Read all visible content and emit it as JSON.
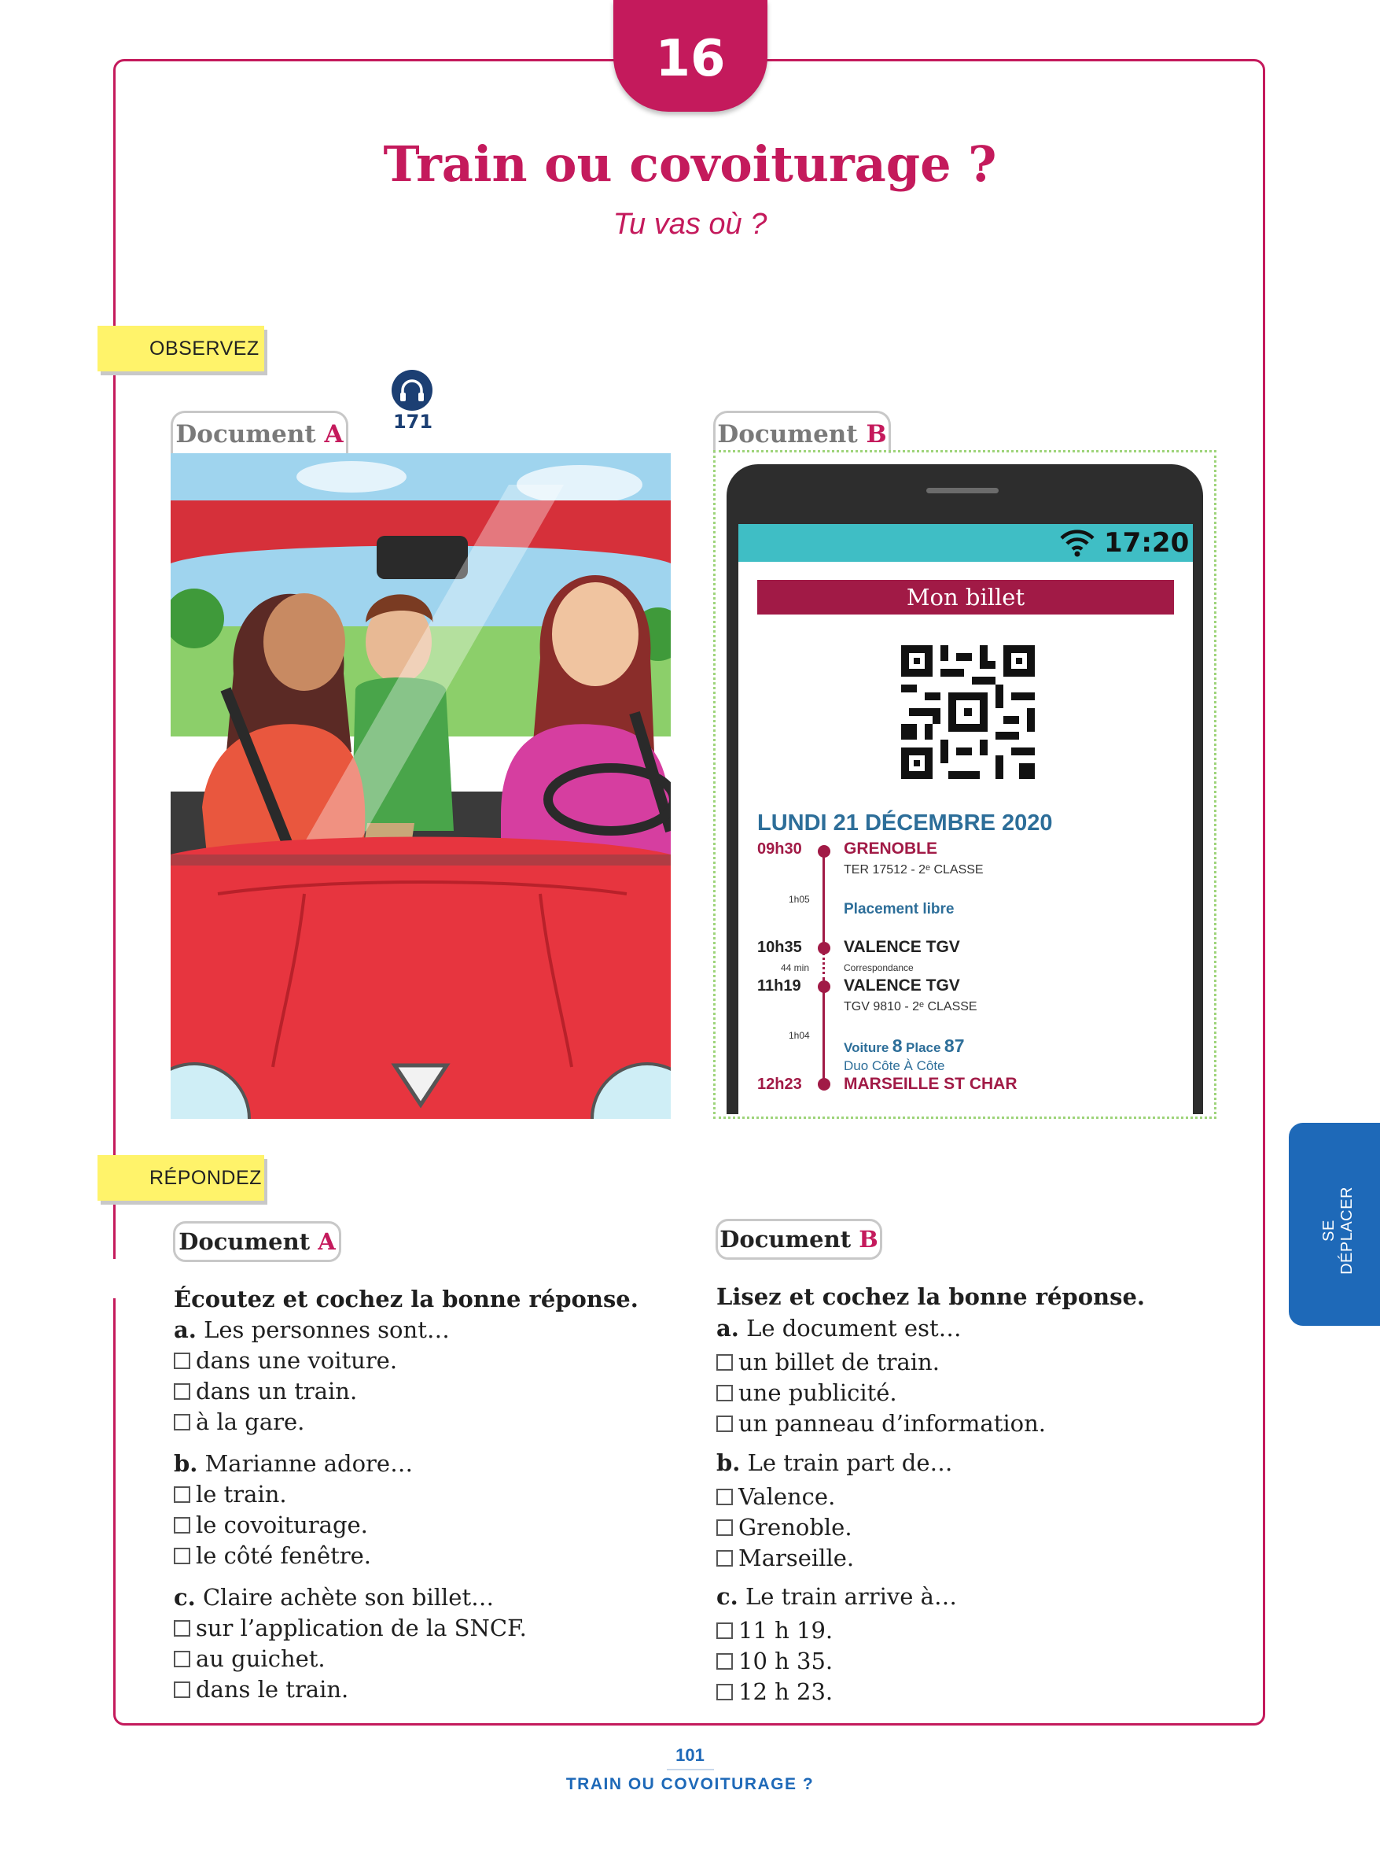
{
  "lesson": {
    "number": "16",
    "title": "Train ou covoiturage ?",
    "subtitle": "Tu vas où ?"
  },
  "sections": {
    "observe": "OBSERVEZ",
    "answer": "RÉPONDEZ"
  },
  "documents": {
    "a_label": "Document",
    "a_letter": "A",
    "b_label": "Document",
    "b_letter": "B"
  },
  "audio": {
    "icon": "headphones-icon",
    "track": "171"
  },
  "ticket": {
    "time": "17:20",
    "banner": "Mon billet",
    "date": "LUNDI 21 DÉCEMBRE 2020",
    "stops": [
      {
        "time": "09h30",
        "station": "GRENOBLE",
        "detail": "TER 17512 - 2ᵉ CLASSE"
      },
      {
        "time": "10h35",
        "station": "VALENCE TGV"
      },
      {
        "time": "11h19",
        "station": "VALENCE TGV",
        "detail": "TGV 9810 - 2ᵉ CLASSE"
      },
      {
        "time": "12h23",
        "station": "MARSEILLE ST CHAR"
      }
    ],
    "leg1_duration": "1h05",
    "leg1_seat": "Placement libre",
    "connection_duration": "44 min",
    "connection_label": "Correspondance",
    "leg2_duration": "1h04",
    "voiture_label": "Voiture",
    "voiture_value": "8",
    "place_label": "Place",
    "place_value": "87",
    "duo_label": "Duo Côte À Côte"
  },
  "doc_a_questions": {
    "instruction": "Écoutez et cochez la bonne réponse.",
    "questions": [
      {
        "letter": "a.",
        "stem": "Les personnes sont…",
        "options": [
          "dans une voiture.",
          "dans un train.",
          "à la gare."
        ]
      },
      {
        "letter": "b.",
        "stem": "Marianne adore…",
        "options": [
          "le train.",
          "le covoiturage.",
          "le côté fenêtre."
        ]
      },
      {
        "letter": "c.",
        "stem": "Claire achète son billet…",
        "options": [
          "sur l’application de la SNCF.",
          "au guichet.",
          "dans le train."
        ]
      }
    ]
  },
  "doc_b_questions": {
    "instruction": "Lisez et cochez la bonne réponse.",
    "questions": [
      {
        "letter": "a.",
        "stem": "Le document est…",
        "options": [
          "un billet de train.",
          "une publicité.",
          "un panneau d’information."
        ]
      },
      {
        "letter": "b.",
        "stem": "Le train part de…",
        "options": [
          "Valence.",
          "Grenoble.",
          "Marseille."
        ]
      },
      {
        "letter": "c.",
        "stem": "Le train arrive à…",
        "options": [
          "11 h 19.",
          "10 h 35.",
          "12 h 23."
        ]
      }
    ]
  },
  "side_tab": "SE DÉPLACER",
  "footer": {
    "page_number": "101",
    "title": "TRAIN OU COVOITURAGE ?"
  }
}
